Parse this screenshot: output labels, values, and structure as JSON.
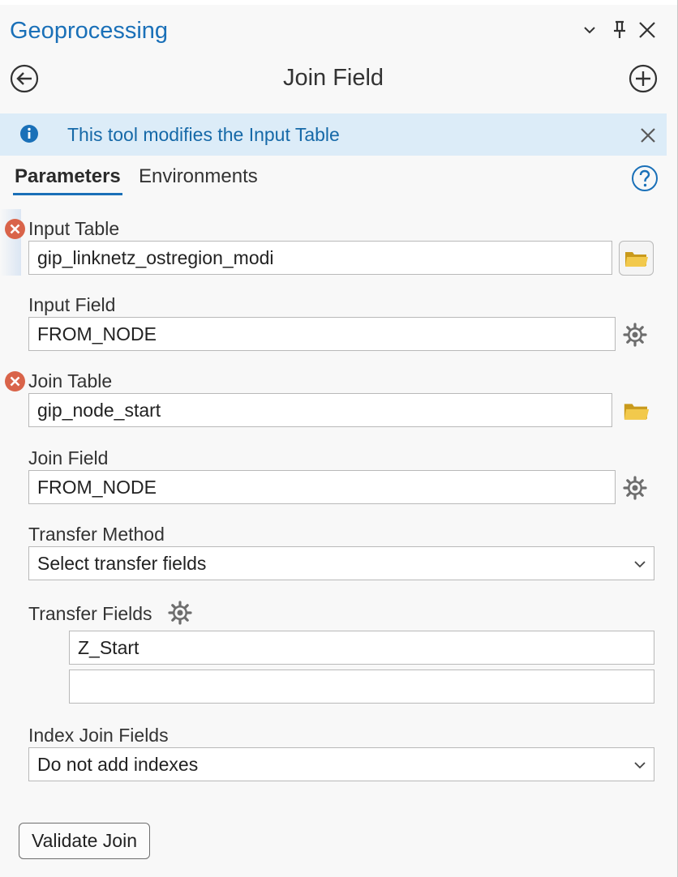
{
  "pane": {
    "title": "Geoprocessing",
    "tool_title": "Join Field"
  },
  "banner": {
    "message": "This tool modifies the Input Table"
  },
  "tabs": {
    "parameters": "Parameters",
    "environments": "Environments"
  },
  "params": {
    "input_table": {
      "label": "Input Table",
      "value": "gip_linknetz_ostregion_modi"
    },
    "input_field": {
      "label": "Input Field",
      "value": "FROM_NODE"
    },
    "join_table": {
      "label": "Join Table",
      "value": "gip_node_start"
    },
    "join_field": {
      "label": "Join Field",
      "value": "FROM_NODE"
    },
    "transfer_method": {
      "label": "Transfer Method",
      "value": "Select transfer fields"
    },
    "transfer_fields": {
      "label": "Transfer Fields",
      "values": [
        "Z_Start",
        ""
      ]
    },
    "index_join_fields": {
      "label": "Index Join Fields",
      "value": "Do not add indexes"
    }
  },
  "buttons": {
    "validate": "Validate Join"
  },
  "colors": {
    "accent": "#1a70b8",
    "error": "#d9644a",
    "banner_bg": "#dcecf8",
    "folder": "#e0b32a"
  },
  "icons": [
    "chevron-down-icon",
    "pin-icon",
    "close-icon",
    "back-arrow-icon",
    "add-circle-icon",
    "info-icon",
    "help-icon",
    "error-icon",
    "folder-icon",
    "gear-icon"
  ]
}
